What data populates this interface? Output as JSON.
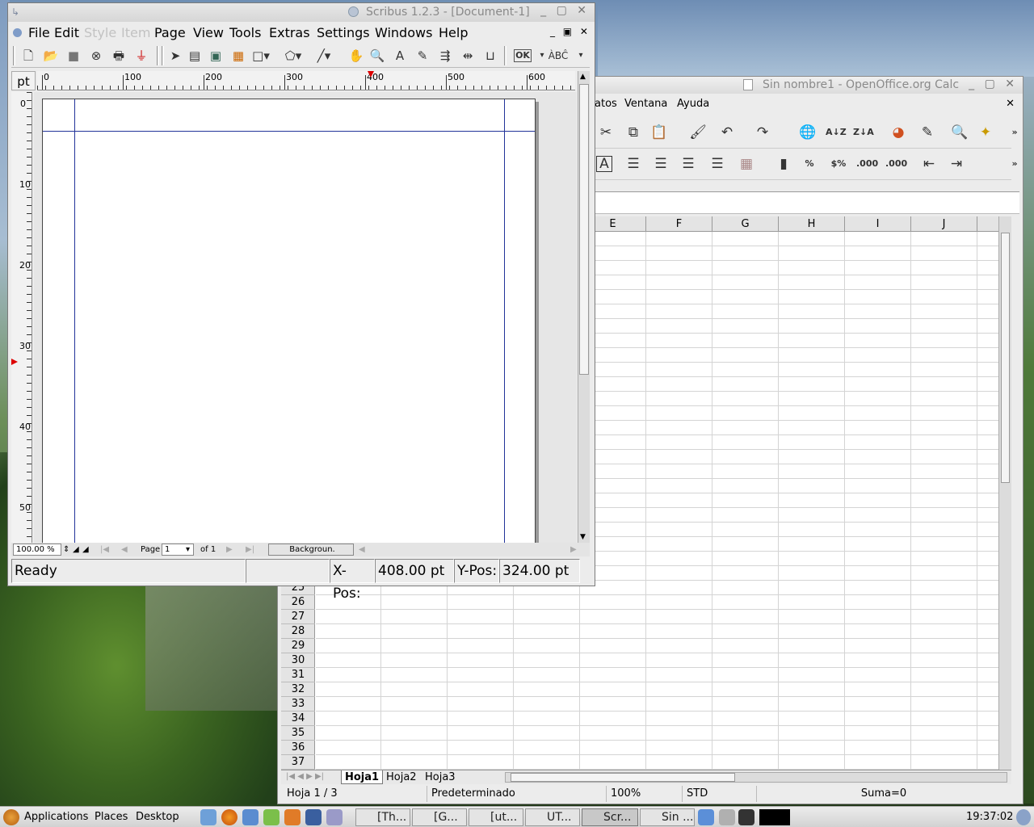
{
  "calc": {
    "title": "Sin nombre1 - OpenOffice.org Calc",
    "menu": [
      "atos",
      "Ventana",
      "Ayuda"
    ],
    "columns": [
      "E",
      "F",
      "G",
      "H",
      "I",
      "J"
    ],
    "rows": [
      "25",
      "26",
      "27",
      "28",
      "29",
      "30",
      "31",
      "32",
      "33",
      "34",
      "35",
      "36",
      "37"
    ],
    "sheets": [
      "Hoja1",
      "Hoja2",
      "Hoja3"
    ],
    "status": {
      "sheet": "Hoja 1 / 3",
      "style": "Predeterminado",
      "zoom": "100%",
      "mode": "STD",
      "sum": "Suma=0"
    },
    "toolbar_icons": [
      "cut-icon",
      "copy-icon",
      "paste-icon",
      "clone-format-icon",
      "undo-icon",
      "redo-icon",
      "hyperlink-icon",
      "sort-ascending-icon",
      "sort-descending-icon",
      "chart-icon",
      "draw-icon",
      "find-icon",
      "navigator-icon"
    ],
    "format_labels": [
      "A",
      "%",
      "$%",
      ".000",
      ".000"
    ]
  },
  "scribus": {
    "title": "Scribus 1.2.3 - [Document-1]",
    "menu": [
      {
        "label": "File",
        "disabled": false
      },
      {
        "label": "Edit",
        "disabled": false
      },
      {
        "label": "Style",
        "disabled": true
      },
      {
        "label": "Item",
        "disabled": true
      },
      {
        "label": "Page",
        "disabled": false
      },
      {
        "label": "View",
        "disabled": false
      },
      {
        "label": "Tools",
        "disabled": false
      },
      {
        "label": "Extras",
        "disabled": false
      },
      {
        "label": "Settings",
        "disabled": false
      },
      {
        "label": "Windows",
        "disabled": false
      },
      {
        "label": "Help",
        "disabled": false
      }
    ],
    "ruler_unit": "pt",
    "hruler_labels": [
      "0",
      "100",
      "200",
      "300",
      "400",
      "500",
      "600"
    ],
    "vruler_labels": [
      "0",
      "10",
      "20",
      "30",
      "40",
      "50"
    ],
    "zoom": "100.00 %",
    "page_label": "Page",
    "page_value": "1",
    "page_of": "of 1",
    "layer": "Backgroun.",
    "status_ready": "Ready",
    "xpos_label": "X-Pos:",
    "xpos_value": "408.00 pt",
    "ypos_label": "Y-Pos:",
    "ypos_value": "324.00 pt",
    "toolbar_text": {
      "ok": "OK",
      "spell": "ÀBĈ"
    }
  },
  "taskbar": {
    "menus": [
      "Applications",
      "Places",
      "Desktop"
    ],
    "tasks": [
      "[Th...",
      "[G...",
      "[ut...",
      "UT...",
      "Scr...",
      "Sin ..."
    ],
    "clock": "19:37:02"
  }
}
